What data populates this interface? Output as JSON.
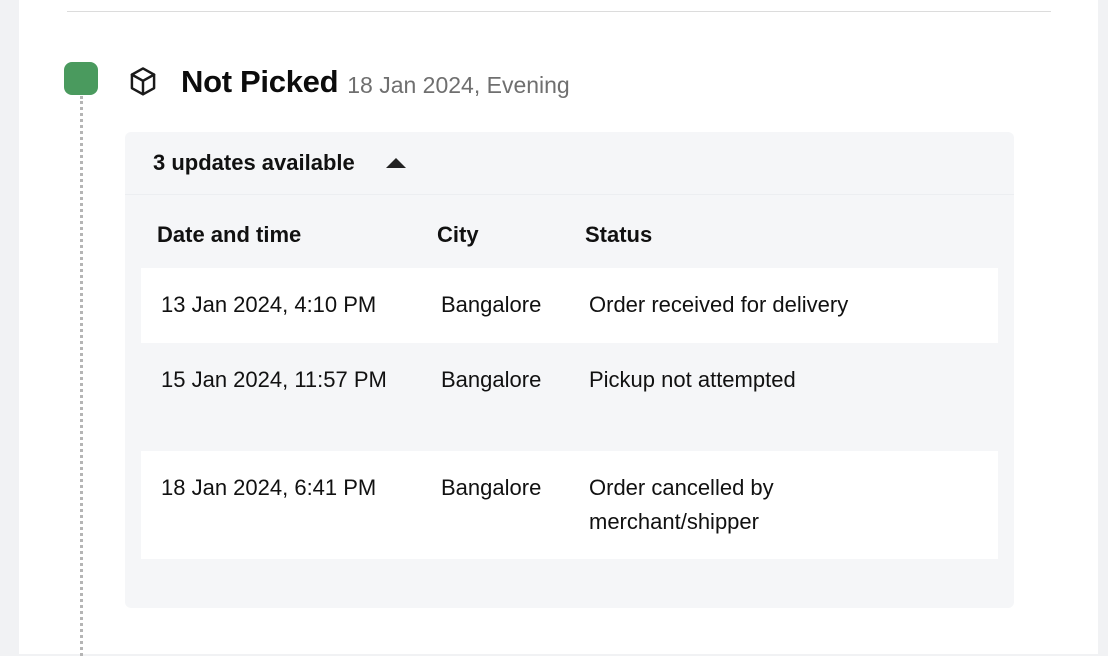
{
  "shipment_event": {
    "status_title": "Not Picked",
    "status_date": "18 Jan 2024, Evening",
    "status_color": "#4a9a5e",
    "icon": "package-box-icon"
  },
  "updates_panel": {
    "toggle_label": "3 updates available",
    "toggle_icon": "caret-up-icon",
    "expanded": true,
    "columns": [
      "Date and time",
      "City",
      "Status"
    ],
    "rows": [
      {
        "datetime": "13 Jan 2024, 4:10 PM",
        "city": "Bangalore",
        "status": "Order received for delivery"
      },
      {
        "datetime": "15 Jan 2024, 11:57 PM",
        "city": "Bangalore",
        "status": "Pickup not attempted"
      },
      {
        "datetime": "18 Jan 2024, 6:41 PM",
        "city": "Bangalore",
        "status": "Order cancelled by merchant/shipper"
      }
    ]
  }
}
